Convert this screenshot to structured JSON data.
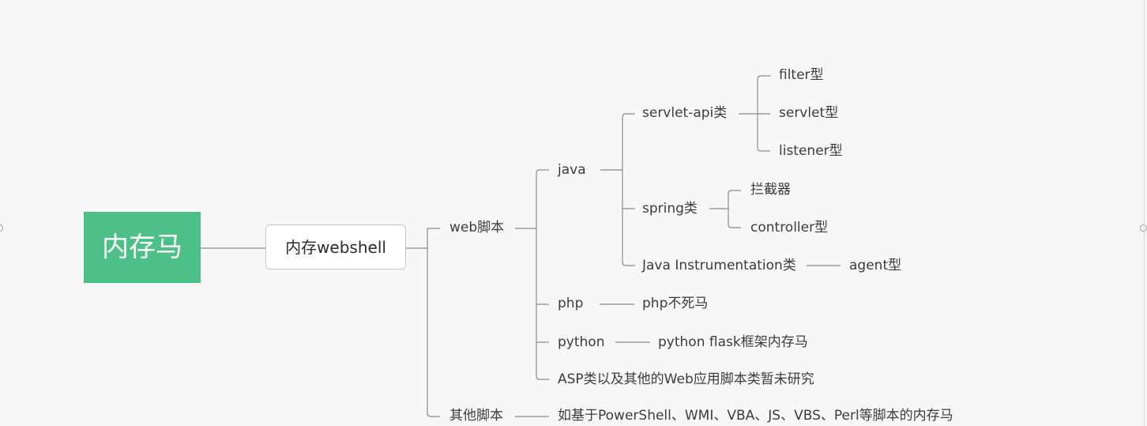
{
  "mindmap": {
    "root": "内存马",
    "level1": "内存webshell",
    "web_scripts": "web脚本",
    "other_scripts": "其他脚本",
    "java": "java",
    "servlet_api": "servlet-api类",
    "filter": "filter型",
    "servlet": "servlet型",
    "listener": "listener型",
    "spring": "spring类",
    "interceptor": "拦截器",
    "controller": "controller型",
    "java_instrumentation": "Java Instrumentation类",
    "agent": "agent型",
    "php": "php",
    "php_shell": "php不死马",
    "python": "python",
    "python_flask": "python flask框架内存马",
    "asp_other": "ASP类以及其他的Web应用脚本类暂未研究",
    "other_detail": "如基于PowerShell、WMI、VBA、JS、VBS、Perl等脚本的内存马"
  },
  "colors": {
    "root_fill": "#4cc086",
    "connector": "#8a8a8a",
    "background": "#f7f7f7"
  }
}
